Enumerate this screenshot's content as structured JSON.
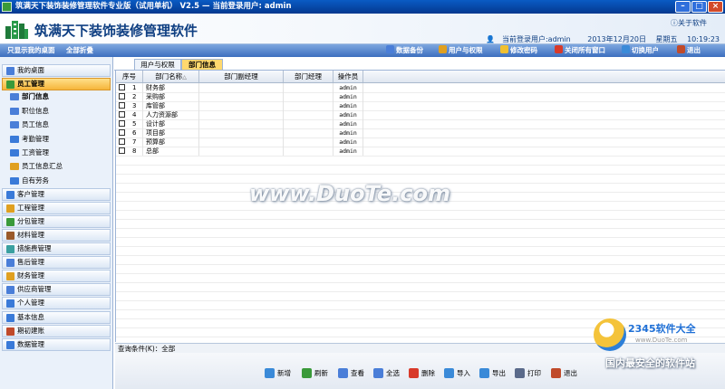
{
  "window": {
    "title": "筑满天下装饰装修管理软件专业版（试用单机） V2.5 —  当前登录用户: admin"
  },
  "header": {
    "app_title": "筑满天下装饰装修管理软件",
    "about": "关于软件",
    "current_user": "当前登录用户:admin",
    "date": "2013年12月20日",
    "weekday": "星期五",
    "time": "10:19:23"
  },
  "toolbar": {
    "show_desktop": "只显示我的桌面",
    "collapse_all": "全部折叠",
    "items": [
      {
        "label": "数据备份",
        "icon": "backup-icon",
        "color": "#4a7ed8"
      },
      {
        "label": "用户与权限",
        "icon": "users-icon",
        "color": "#e0a020"
      },
      {
        "label": "修改密码",
        "icon": "key-icon",
        "color": "#f0c030"
      },
      {
        "label": "关闭所有窗口",
        "icon": "close-all-icon",
        "color": "#d83a2a"
      },
      {
        "label": "切换用户",
        "icon": "switch-user-icon",
        "color": "#3a8ad8"
      },
      {
        "label": "退出",
        "icon": "exit-icon",
        "color": "#c04a2a"
      }
    ]
  },
  "sidebar": {
    "items": [
      {
        "label": "我的桌面",
        "icon": "desktop-icon",
        "color": "#4a7ed8"
      },
      {
        "label": "员工管理",
        "icon": "employee-icon",
        "color": "#3a9a3a",
        "active": true
      },
      {
        "label": "客户管理",
        "icon": "customer-icon",
        "color": "#3a7ad8"
      },
      {
        "label": "工程管理",
        "icon": "project-icon",
        "color": "#e0a020"
      },
      {
        "label": "分包管理",
        "icon": "subcontract-icon",
        "color": "#3a9a3a"
      },
      {
        "label": "材料管理",
        "icon": "material-icon",
        "color": "#9a5a2a"
      },
      {
        "label": "措施费管理",
        "icon": "measure-fee-icon",
        "color": "#3aa0a0"
      },
      {
        "label": "售后管理",
        "icon": "after-sale-icon",
        "color": "#4a7ed8"
      },
      {
        "label": "财务管理",
        "icon": "finance-icon",
        "color": "#e0a020"
      },
      {
        "label": "供应商管理",
        "icon": "supplier-icon",
        "color": "#4a7ed8"
      },
      {
        "label": "个人管理",
        "icon": "personal-icon",
        "color": "#3a7ad8"
      },
      {
        "label": "基本信息",
        "icon": "basic-info-icon",
        "color": "#3a7ad8"
      },
      {
        "label": "期初建账",
        "icon": "opening-account-icon",
        "color": "#c04a2a"
      },
      {
        "label": "数据管理",
        "icon": "data-icon",
        "color": "#3a7ad8"
      }
    ],
    "subitems": [
      {
        "label": "部门信息",
        "icon": "department-icon",
        "color": "#4a7ed8",
        "selected": true
      },
      {
        "label": "职位信息",
        "icon": "position-icon",
        "color": "#4a7ed8"
      },
      {
        "label": "员工信息",
        "icon": "staff-info-icon",
        "color": "#4a7ed8"
      },
      {
        "label": "考勤管理",
        "icon": "folder-icon",
        "color": "#3a7ad8"
      },
      {
        "label": "工资管理",
        "icon": "folder-icon",
        "color": "#3a7ad8"
      },
      {
        "label": "员工信息汇总",
        "icon": "chart-icon",
        "color": "#e0a020"
      },
      {
        "label": "自有劳务",
        "icon": "folder-icon",
        "color": "#3a7ad8"
      }
    ]
  },
  "tabs": [
    {
      "label": "用户与权限"
    },
    {
      "label": "部门信息",
      "active": true
    }
  ],
  "grid": {
    "headers": [
      "序号",
      "部门名称",
      "部门副经理",
      "部门经理",
      "操作员"
    ],
    "sort_indicator": "△",
    "rows": [
      {
        "no": "1",
        "name": "财务部",
        "deputy": "",
        "manager": "",
        "operator": "admin"
      },
      {
        "no": "2",
        "name": "采购部",
        "deputy": "",
        "manager": "",
        "operator": "admin"
      },
      {
        "no": "3",
        "name": "库管部",
        "deputy": "",
        "manager": "",
        "operator": "admin"
      },
      {
        "no": "4",
        "name": "人力资源部",
        "deputy": "",
        "manager": "",
        "operator": "admin"
      },
      {
        "no": "5",
        "name": "设计部",
        "deputy": "",
        "manager": "",
        "operator": "admin"
      },
      {
        "no": "6",
        "name": "项目部",
        "deputy": "",
        "manager": "",
        "operator": "admin"
      },
      {
        "no": "7",
        "name": "预算部",
        "deputy": "",
        "manager": "",
        "operator": "admin"
      },
      {
        "no": "8",
        "name": "总部",
        "deputy": "",
        "manager": "",
        "operator": "admin"
      }
    ]
  },
  "query": {
    "label": "查询条件(K)：全部"
  },
  "actions": [
    {
      "label": "新增",
      "icon": "add-icon",
      "color": "#3a8ad8"
    },
    {
      "label": "刷新",
      "icon": "refresh-icon",
      "color": "#3a9a3a"
    },
    {
      "label": "查看",
      "icon": "view-icon",
      "color": "#4a7ed8"
    },
    {
      "label": "全选",
      "icon": "select-all-icon",
      "color": "#4a7ed8"
    },
    {
      "label": "删除",
      "icon": "delete-icon",
      "color": "#d83a2a"
    },
    {
      "label": "导入",
      "icon": "import-icon",
      "color": "#3a8ad8"
    },
    {
      "label": "导出",
      "icon": "export-icon",
      "color": "#3a8ad8"
    },
    {
      "label": "打印",
      "icon": "print-icon",
      "color": "#5a6a8a"
    },
    {
      "label": "退出",
      "icon": "exit-icon",
      "color": "#c04a2a"
    }
  ],
  "watermarks": {
    "duote": "www.DuoTe.com",
    "brand": "2345软件大全",
    "site": "www.DuoTe.com",
    "slogan": "国内最安全的软件站"
  }
}
